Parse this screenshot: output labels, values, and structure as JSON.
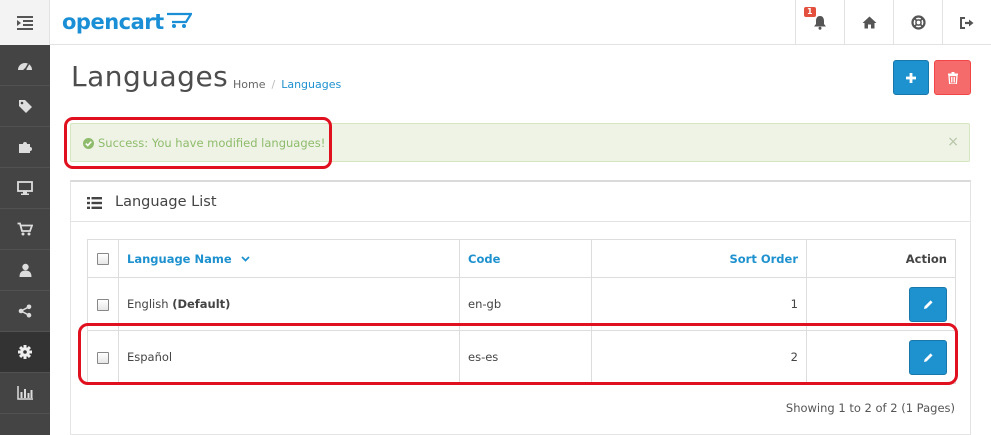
{
  "header": {
    "logo_text": "opencart",
    "notification_count": "1"
  },
  "sidebar": {
    "items": [
      {
        "icon": "dashboard-icon"
      },
      {
        "icon": "tags-icon"
      },
      {
        "icon": "puzzle-icon"
      },
      {
        "icon": "desktop-icon"
      },
      {
        "icon": "cart-icon"
      },
      {
        "icon": "user-icon"
      },
      {
        "icon": "share-icon"
      },
      {
        "icon": "gear-icon",
        "active": true
      },
      {
        "icon": "bar-chart-icon"
      }
    ]
  },
  "page": {
    "title": "Languages",
    "breadcrumb": {
      "home": "Home",
      "separator": "/",
      "current": "Languages"
    }
  },
  "alert": {
    "text": "Success: You have modified languages!",
    "close": "×"
  },
  "panel": {
    "title": "Language List"
  },
  "table": {
    "headers": {
      "name": "Language Name",
      "code": "Code",
      "sort_order": "Sort Order",
      "action": "Action"
    },
    "rows": [
      {
        "name": "English",
        "default_label": "(Default)",
        "code": "en-gb",
        "sort_order": "1"
      },
      {
        "name": "Español",
        "default_label": "",
        "code": "es-es",
        "sort_order": "2"
      }
    ]
  },
  "pagination": {
    "text": "Showing 1 to 2 of 2 (1 Pages)"
  },
  "colors": {
    "primary": "#1e91cf",
    "danger": "#f56b6b",
    "sidebar_bg": "#444444",
    "success_text": "#8fbb6c",
    "annotation": "#e0101e"
  }
}
